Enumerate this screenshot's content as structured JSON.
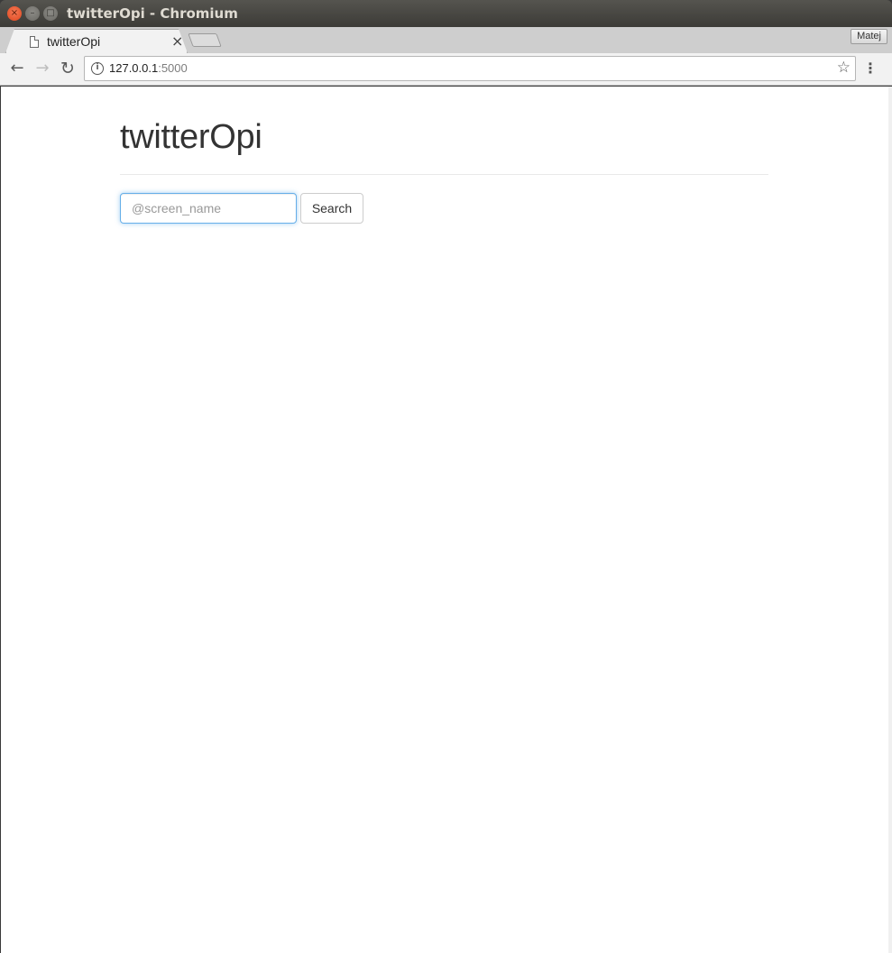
{
  "window": {
    "title": "twitterOpi - Chromium",
    "close_glyph": "×",
    "min_glyph": "–",
    "max_glyph": "□"
  },
  "tabs": [
    {
      "label": "twitterOpi",
      "close_glyph": "×",
      "icon": "page-icon"
    }
  ],
  "profile": {
    "name": "Matej"
  },
  "toolbar": {
    "back_glyph": "←",
    "forward_glyph": "→",
    "reload_glyph": "↻",
    "info_glyph": "i",
    "url_host": "127.0.0.1",
    "url_port": ":5000",
    "star_glyph": "☆",
    "menu_glyph": "⋮"
  },
  "page": {
    "title": "twitterOpi",
    "search": {
      "placeholder": "@screen_name",
      "value": "",
      "button_label": "Search"
    }
  },
  "colors": {
    "focus_border": "#66afe9",
    "title_text": "#333333",
    "close_button": "#e0461e"
  }
}
